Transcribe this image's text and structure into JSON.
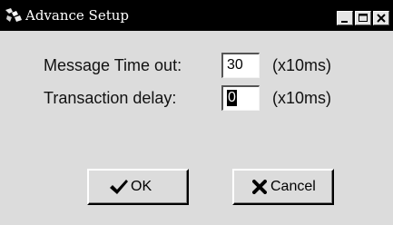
{
  "window": {
    "title": "Advance Setup",
    "controls": {
      "minimize_icon": "minimize-icon",
      "maximize_icon": "maximize-icon",
      "close_icon": "close-icon"
    }
  },
  "form": {
    "fields": [
      {
        "label": "Message Time out:",
        "value": "30",
        "unit": "(x10ms)"
      },
      {
        "label": "Transaction delay:",
        "value": "0",
        "unit": "(x10ms)"
      }
    ]
  },
  "buttons": {
    "ok_label": "OK",
    "ok_icon": "checkmark-icon",
    "cancel_label": "Cancel",
    "cancel_icon": "x-icon"
  },
  "colors": {
    "titlebar": "#000000",
    "dialog_bg": "#dcdcdc"
  }
}
